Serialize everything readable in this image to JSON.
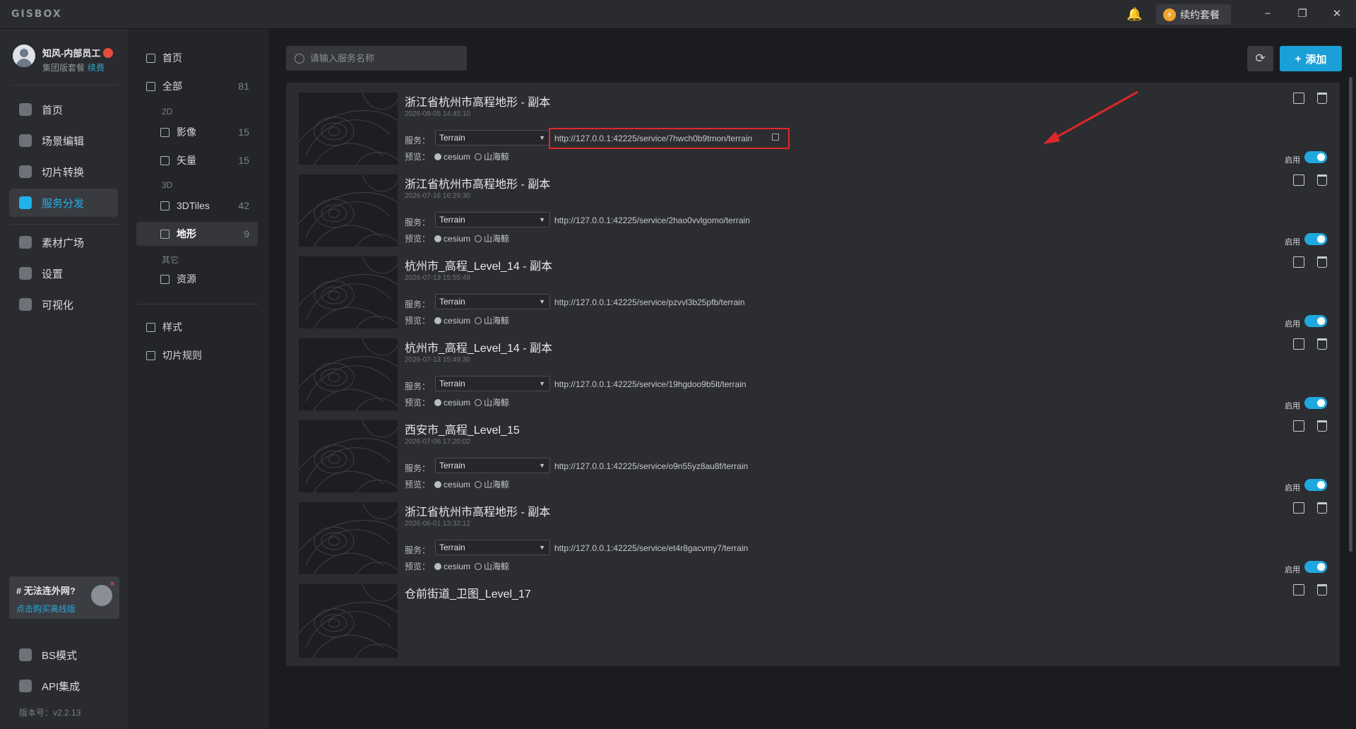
{
  "app": {
    "logo": "GISBOX"
  },
  "titlebar": {
    "renew_label": "续约套餐",
    "minimize": "−",
    "restore": "❐",
    "close": "✕"
  },
  "user": {
    "name": "知风-内部员工",
    "plan": "集团版套餐",
    "renew": "续费"
  },
  "leftnav": {
    "items": [
      {
        "label": "首页",
        "icon": "home-icon"
      },
      {
        "label": "场景编辑",
        "icon": "cube-icon"
      },
      {
        "label": "切片转换",
        "icon": "convert-icon"
      },
      {
        "label": "服务分发",
        "icon": "upload-icon",
        "active": true
      },
      {
        "label": "素材广场",
        "icon": "image-icon"
      },
      {
        "label": "设置",
        "icon": "settings-icon"
      },
      {
        "label": "可视化",
        "icon": "visual-icon"
      }
    ],
    "offline": {
      "title": "# 无法连外网?",
      "link": "点击购买离线版"
    },
    "bottom_items": [
      {
        "label": "BS模式",
        "icon": "code-icon"
      },
      {
        "label": "API集成",
        "icon": "api-icon"
      }
    ],
    "version": "版本号：v2.2.13"
  },
  "midnav": {
    "home": "首页",
    "all": {
      "label": "全部",
      "count": "81"
    },
    "section_2d": "2D",
    "imagery": {
      "label": "影像",
      "count": "15"
    },
    "vector": {
      "label": "矢量",
      "count": "15"
    },
    "section_3d": "3D",
    "tiles3d": {
      "label": "3DTiles",
      "count": "42"
    },
    "terrain": {
      "label": "地形",
      "count": "9"
    },
    "section_other": "其它",
    "resource": {
      "label": "资源"
    },
    "style": {
      "label": "样式"
    },
    "tile_rule": {
      "label": "切片规则"
    }
  },
  "toolbar": {
    "search_placeholder": "请输入服务名称",
    "add_label": "添加",
    "refresh": "⟳",
    "plus": "+"
  },
  "card_labels": {
    "service": "服务：",
    "preview": "预览：",
    "cesium": "cesium",
    "shanhaijing": "山海鲸",
    "enable": "启用",
    "service_type": "Terrain"
  },
  "cards": [
    {
      "title": "浙江省杭州市高程地形 - 副本",
      "date": "2026-08-05 14:45:10",
      "url": "http://127.0.0.1:42225/service/7hwch0b9tmon/terrain",
      "highlight": true
    },
    {
      "title": "浙江省杭州市高程地形 - 副本",
      "date": "2026-07-16 16:29:30",
      "url": "http://127.0.0.1:42225/service/2hao0vvlgomo/terrain"
    },
    {
      "title": "杭州市_高程_Level_14 - 副本",
      "date": "2026-07-13 15:55:49",
      "url": "http://127.0.0.1:42225/service/pzvvl3b25pfb/terrain"
    },
    {
      "title": "杭州市_高程_Level_14 - 副本",
      "date": "2026-07-13 15:49:30",
      "url": "http://127.0.0.1:42225/service/19hgdoo9b5lt/terrain"
    },
    {
      "title": "西安市_高程_Level_15",
      "date": "2026-07-06 17:20:02",
      "url": "http://127.0.0.1:42225/service/o9n55yz8au8f/terrain"
    },
    {
      "title": "浙江省杭州市高程地形 - 副本",
      "date": "2026-06-01 13:32:12",
      "url": "http://127.0.0.1:42225/service/et4r8gacvmy7/terrain"
    },
    {
      "title": "仓前街道_卫图_Level_17",
      "date": "",
      "url": ""
    }
  ]
}
